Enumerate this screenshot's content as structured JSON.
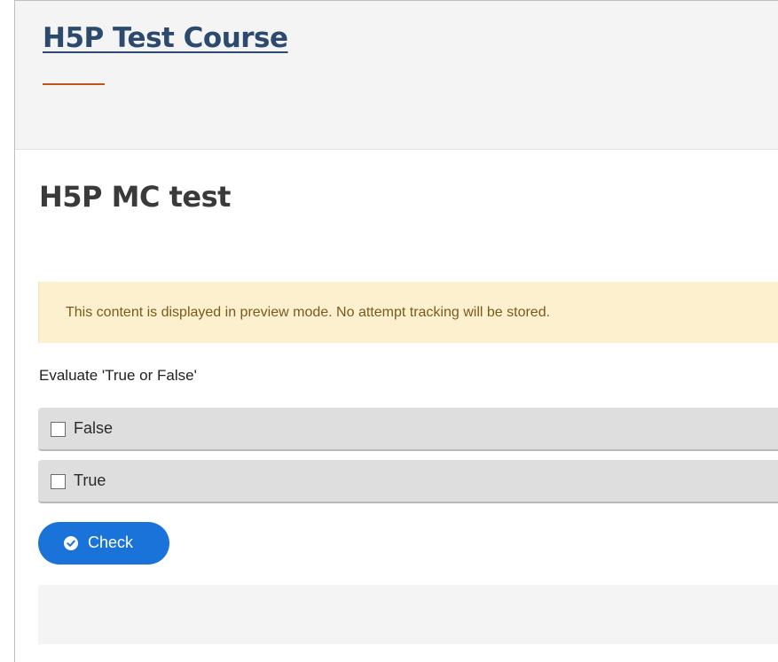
{
  "course": {
    "title": "H5P Test Course"
  },
  "page": {
    "title": "H5P MC test"
  },
  "notice": {
    "text": "This content is displayed in preview mode. No attempt tracking will be stored."
  },
  "question": {
    "text": "Evaluate 'True or False'",
    "answers": [
      {
        "label": "False",
        "checked": false
      },
      {
        "label": "True",
        "checked": false
      }
    ]
  },
  "actions": {
    "check_label": "Check",
    "check_icon": "check-circle-icon"
  },
  "colors": {
    "link": "#2b4a6e",
    "accent": "#c0521b",
    "notice_bg": "#fdf0cf",
    "button": "#1a73d9"
  }
}
